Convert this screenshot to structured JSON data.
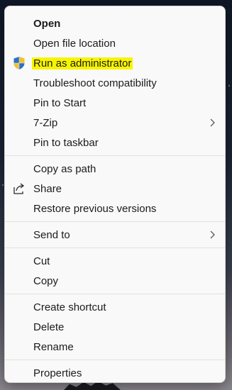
{
  "menu": {
    "groups": [
      [
        {
          "label": "Open",
          "bold": true
        },
        {
          "label": "Open file location"
        },
        {
          "label": "Run as administrator",
          "icon": "uac-shield-icon",
          "highlighted": true
        },
        {
          "label": "Troubleshoot compatibility"
        },
        {
          "label": "Pin to Start"
        },
        {
          "label": "7-Zip",
          "submenu": true
        },
        {
          "label": "Pin to taskbar"
        }
      ],
      [
        {
          "label": "Copy as path"
        },
        {
          "label": "Share",
          "icon": "share-icon"
        },
        {
          "label": "Restore previous versions"
        }
      ],
      [
        {
          "label": "Send to",
          "submenu": true
        }
      ],
      [
        {
          "label": "Cut"
        },
        {
          "label": "Copy"
        }
      ],
      [
        {
          "label": "Create shortcut"
        },
        {
          "label": "Delete"
        },
        {
          "label": "Rename"
        }
      ],
      [
        {
          "label": "Properties"
        }
      ]
    ]
  },
  "colors": {
    "highlight": "#f8f400",
    "menu_background": "#f9f9f9",
    "separator": "#e1e1e1"
  }
}
